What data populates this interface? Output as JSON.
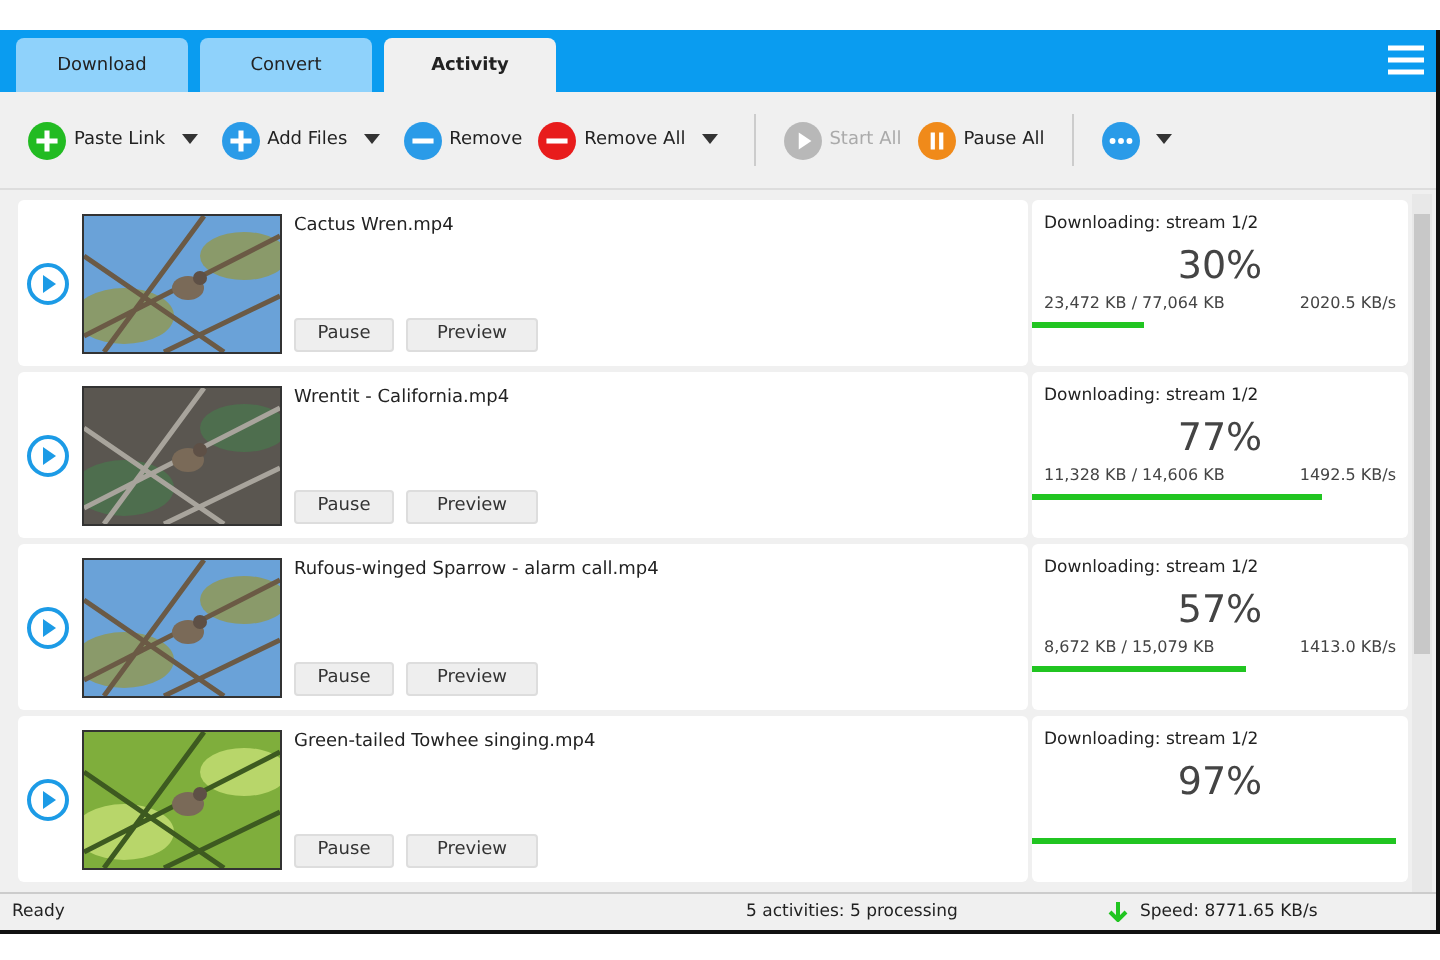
{
  "tabs": [
    {
      "label": "Download",
      "selected": false
    },
    {
      "label": "Convert",
      "selected": false
    },
    {
      "label": "Activity",
      "selected": true
    }
  ],
  "toolbar": [
    {
      "kind": "add",
      "label": "Paste Link",
      "dropdown": true,
      "disabled": false,
      "color": "#22bb22"
    },
    {
      "kind": "add",
      "label": "Add Files",
      "dropdown": true,
      "disabled": false,
      "color": "#2a9be8"
    },
    {
      "kind": "remove",
      "label": "Remove",
      "dropdown": false,
      "disabled": false,
      "color": "#2a9be8"
    },
    {
      "kind": "remove",
      "label": "Remove All",
      "dropdown": true,
      "disabled": false,
      "color": "#e81c1c"
    },
    {
      "kind": "separator"
    },
    {
      "kind": "start",
      "label": "Start All",
      "dropdown": false,
      "disabled": true,
      "color": "#b8b8b8"
    },
    {
      "kind": "pause",
      "label": "Pause All",
      "dropdown": false,
      "disabled": false,
      "color": "#f08a1a"
    },
    {
      "kind": "separator"
    },
    {
      "kind": "more",
      "dropdown": true,
      "color": "#2a9be8"
    }
  ],
  "activities": [
    {
      "title": "Cactus Wren.mp4",
      "pause": "Pause",
      "preview": "Preview",
      "status": "Downloading: stream 1/2",
      "percent": "30%",
      "size": "23,472 KB / 77,064 KB",
      "speed": "2020.5 KB/s",
      "level": 0.3
    },
    {
      "title": "Wrentit - California.mp4",
      "pause": "Pause",
      "preview": "Preview",
      "status": "Downloading: stream 1/2",
      "percent": "77%",
      "size": "11,328 KB / 14,606 KB",
      "speed": "1492.5 KB/s",
      "level": 0.77
    },
    {
      "title": "Rufous-winged Sparrow - alarm call.mp4",
      "pause": "Pause",
      "preview": "Preview",
      "status": "Downloading: stream 1/2",
      "percent": "57%",
      "size": "8,672 KB / 15,079 KB",
      "speed": "1413.0 KB/s",
      "level": 0.57
    },
    {
      "title": "Green-tailed Towhee singing.mp4",
      "pause": "Pause",
      "preview": "Preview",
      "status": "Downloading: stream 1/2",
      "percent": "97%",
      "level": 0.97
    }
  ],
  "status_bar": {
    "left": "Ready",
    "activities": "5 activities: 5 processing",
    "speed": "Speed: 8771.65 KB/s"
  }
}
